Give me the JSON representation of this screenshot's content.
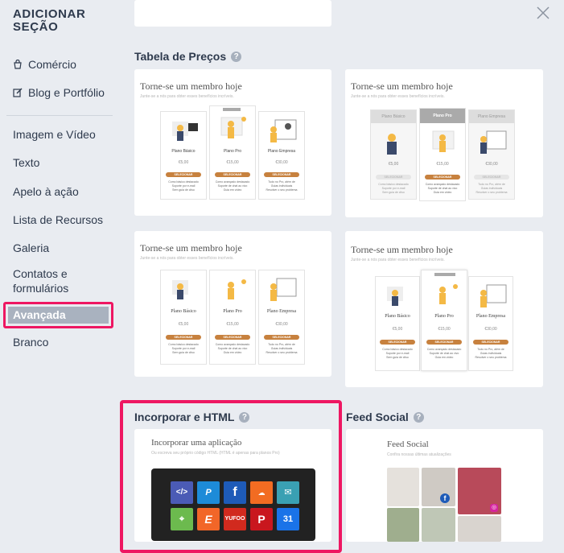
{
  "sidebar": {
    "title_line1": "ADICIONAR",
    "title_line2": "SEÇÃO",
    "commerce": "Comércio",
    "blog": "Blog e Portfólio",
    "items": [
      "Imagem e Vídeo",
      "Texto",
      "Apelo à ação",
      "Lista de Recursos",
      "Galeria",
      "Contatos e",
      "formulários",
      "Avançada",
      "Branco"
    ]
  },
  "sections": {
    "pricing": "Tabela de Preços",
    "embed": "Incorporar e HTML",
    "social": "Feed Social"
  },
  "pricing_card": {
    "title": "Torne-se um membro hoje",
    "subtitle": "Junte-se a nós para obter esses benefícios incríveis.",
    "plans": [
      "Plano Básico",
      "Plano Pro",
      "Plano Empresa"
    ],
    "prices": [
      "€5,00",
      "€15,00",
      "€30,00"
    ],
    "button": "SELECIONAR"
  },
  "embed_card": {
    "title": "Incorporar uma aplicação",
    "subtitle": "Ou escreva seu próprio código HTML (HTML é apenas para planos Pro)"
  },
  "social_card": {
    "title": "Feed Social",
    "subtitle": "Confira nossas últimas atualizações"
  },
  "app_icons": [
    "html-icon",
    "paypal-icon",
    "facebook-icon",
    "soundcloud-icon",
    "mailchimp-icon",
    "maps-icon",
    "eventbrite-icon",
    "yelp-icon",
    "pinterest-icon",
    "calendar-icon"
  ],
  "colors": {
    "accent": "#ee1762",
    "button": "#c7813e",
    "active_bg": "#a9b2bf"
  }
}
